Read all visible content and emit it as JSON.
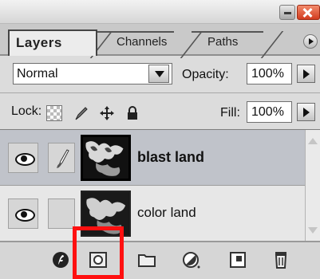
{
  "tabs": [
    {
      "label": "Layers",
      "active": true
    },
    {
      "label": "Channels",
      "active": false
    },
    {
      "label": "Paths",
      "active": false
    }
  ],
  "blend": {
    "mode": "Normal",
    "opacity_label": "Opacity:",
    "opacity_value": "100%"
  },
  "lock": {
    "label": "Lock:",
    "fill_label": "Fill:",
    "fill_value": "100%"
  },
  "layers": [
    {
      "name": "blast land",
      "selected": true,
      "visible": true,
      "linked_icon": "brush-icon"
    },
    {
      "name": "color land",
      "selected": false,
      "visible": true,
      "linked_icon": ""
    }
  ],
  "toolbar_icons": [
    "layer-style-icon",
    "add-mask-icon",
    "new-group-icon",
    "adjustment-layer-icon",
    "new-layer-icon",
    "trash-icon"
  ],
  "colors": {
    "highlight": "#ff1010",
    "selected_row": "#c0c3ca",
    "close_button": "#d23c1f"
  }
}
